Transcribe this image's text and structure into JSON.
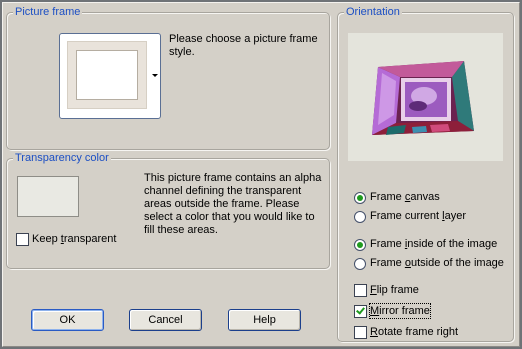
{
  "picture_frame": {
    "title": "Picture frame",
    "description": "Please choose a picture frame style."
  },
  "transparency": {
    "title": "Transparency color",
    "description_lines": [
      "This picture frame contains an alpha",
      "channel defining the transparent",
      "areas outside the frame.  Please",
      "select a color that you would like to",
      "fill these areas."
    ],
    "swatch_color": "#e9e9e3",
    "keep_transparent_label": "Keep transparent",
    "keep_transparent_checked": false
  },
  "orientation": {
    "title": "Orientation",
    "frame_canvas_label": "Frame canvas",
    "frame_current_layer_label": "Frame current layer",
    "frame_inside_label": "Frame inside of the image",
    "frame_outside_label": "Frame outside of the image",
    "flip_frame_label": "Flip frame",
    "mirror_frame_label": "Mirror frame",
    "rotate_frame_right_label": "Rotate frame right",
    "selected_target": "Frame canvas",
    "selected_position": "Frame inside of the image",
    "flip_checked": false,
    "mirror_checked": true,
    "rotate_checked": false
  },
  "buttons": {
    "ok": "OK",
    "cancel": "Cancel",
    "help": "Help"
  },
  "colors": {
    "group_title": "#1c4fc4",
    "check_mark": "#1f9a1f",
    "dialog_bg": "#d4d0c8"
  }
}
